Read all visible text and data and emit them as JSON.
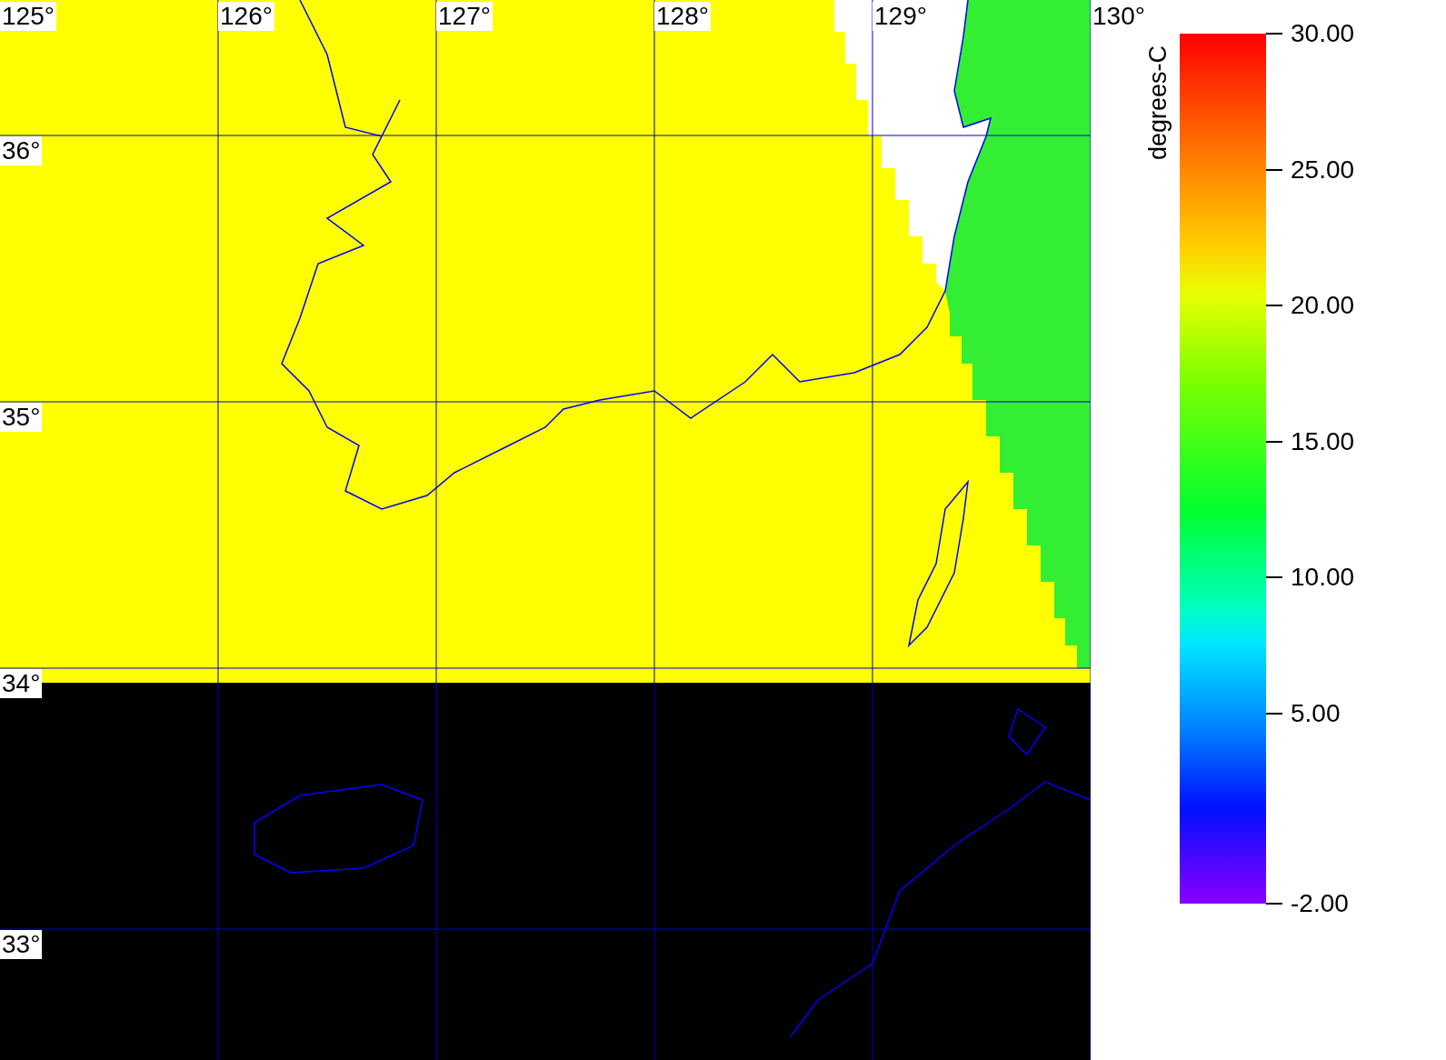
{
  "map": {
    "longitude_labels": [
      "125°",
      "126°",
      "127°",
      "128°",
      "129°",
      "130°"
    ],
    "latitude_labels": [
      "36°",
      "35°",
      "34°",
      "33°"
    ]
  },
  "colorbar": {
    "unit": "degrees-C",
    "ticks": [
      "30.00",
      "25.00",
      "20.00",
      "15.00",
      "10.00",
      "5.00",
      "-2.00"
    ]
  }
}
